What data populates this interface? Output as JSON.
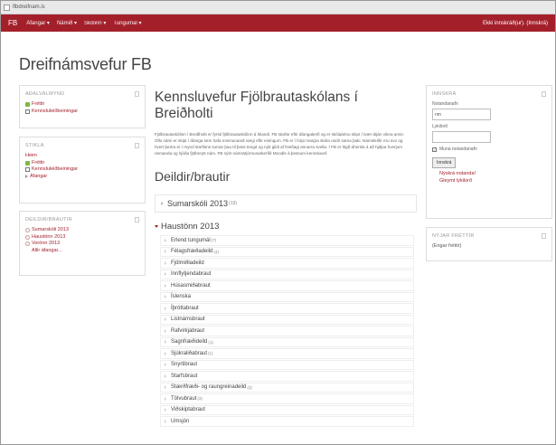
{
  "browser": {
    "tab_title": "flbdreifnam.is"
  },
  "navbar": {
    "brand": "FB",
    "menus": [
      "Áfangar ▾",
      "Námið ▾",
      "Skólinn ▾",
      "Tungumál ▾"
    ],
    "login_status": "Ekki innskráð(ur). (Innskrá)"
  },
  "site_title": "Dreifnámsvefur FB",
  "left_blocks": {
    "main_menu": {
      "title": "AÐALVALMYND",
      "items": [
        "Fréttir",
        "Kennsluleiðbeiningar"
      ]
    },
    "navigation": {
      "title": "STIKLA",
      "home": "Heim",
      "items": [
        "Fréttir",
        "Kennsluleiðbeiningar",
        "Áfangar"
      ]
    },
    "categories": {
      "title": "DEILDIR/BRAUTIR",
      "items": [
        "Sumarskóli 2013",
        "Haustönn 2013",
        "Vorönn 2013"
      ],
      "all_courses": "Allir áfangar..."
    }
  },
  "main": {
    "heading": "Kennsluvefur Fjölbrautaskólans í Breiðholti",
    "intro": "Fjölbrautaskólinn í Breiðholti er fyrsti fjölbrautaskólinn á Íslandi. FB starfar eftir áfangakerfi og er skólaárinu skipt í tvær átján vikna annir. Öllu námi er skipt í áfanga sem hafa mismunandi vægi eftir einingum. FB er í hópi margra skóla undir sama þaki. Námsleiðir eru svo og hvert þeirra er í mynd starfsins sumar þau til þess tengd og nýtt gildi af fræðagi annarra svella. Í FB er lögð áhersla á að hjálpa hverjum nemanda og hjóða fjölbreytt nám. FB nýtir námsstjórnunarkerfið Moodle á þessum kennsluvef.",
    "section_title": "Deildir/brautir",
    "summer": {
      "label": "Sumarskóli 2013",
      "count": "(19)"
    },
    "autumn": {
      "label": "Haustönn 2013",
      "subcategories": [
        {
          "name": "Erlend tungumál",
          "count": "(7)"
        },
        {
          "name": "Félagsfræðadeild",
          "count": "(4)"
        },
        {
          "name": "Fjölmiðladeild",
          "count": ""
        },
        {
          "name": "Innflytjendabraut",
          "count": ""
        },
        {
          "name": "Húsasmiðabraut",
          "count": ""
        },
        {
          "name": "Íslenska",
          "count": ""
        },
        {
          "name": "Íþróttabraut",
          "count": ""
        },
        {
          "name": "Listnámsbraut",
          "count": ""
        },
        {
          "name": "Rafvirkjabraut",
          "count": ""
        },
        {
          "name": "Sagnfræðideild",
          "count": "(1)"
        },
        {
          "name": "Sjúkraliðabraut",
          "count": "(1)"
        },
        {
          "name": "Snyrtibraut",
          "count": ""
        },
        {
          "name": "Starfsbraut",
          "count": ""
        },
        {
          "name": "Stærðfræði- og raungreinadeild",
          "count": "(3)"
        },
        {
          "name": "Tölvubraut",
          "count": "(3)"
        },
        {
          "name": "Viðskiptabraut",
          "count": ""
        },
        {
          "name": "Umsjón",
          "count": ""
        }
      ]
    }
  },
  "right_blocks": {
    "login": {
      "title": "INNSKRÁ",
      "username_label": "Notandanafn",
      "username_value": "nm",
      "password_label": "Lykilorð",
      "remember_label": "Muna notandanafn",
      "remember_checked": true,
      "login_button": "Innskrá",
      "new_account": "Nýskrá notanda!",
      "forgot_password": "Gleymt lykilorð"
    },
    "news": {
      "title": "NÝJAR FRÉTTIR",
      "empty": "(Engar fréttir)"
    }
  }
}
